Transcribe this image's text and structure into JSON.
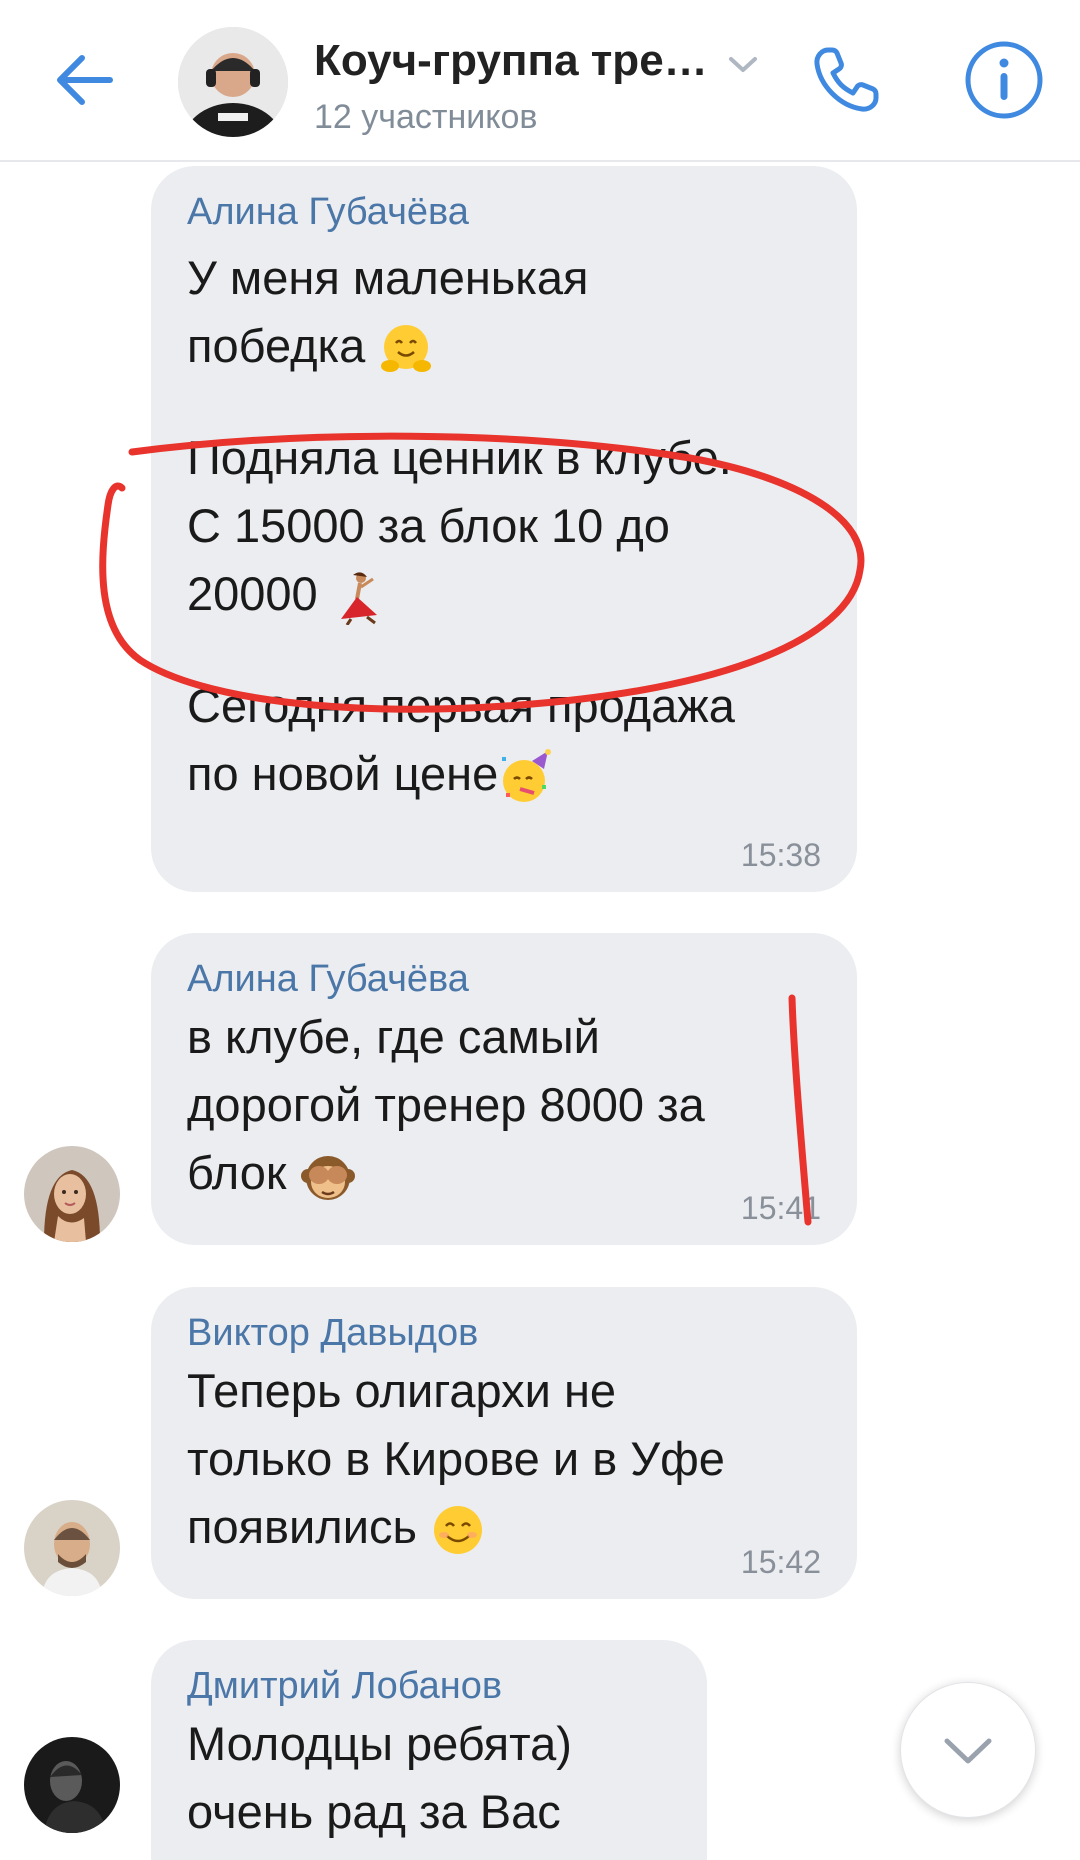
{
  "header": {
    "title": "Коуч-группа тре…",
    "subtitle": "12 участников",
    "accent_color": "#3f8ae0",
    "icons": {
      "back": "arrow-left-icon",
      "dropdown": "chevron-down-icon",
      "call": "phone-icon",
      "info": "info-icon"
    }
  },
  "messages": [
    {
      "sender": "Алина Губачёва",
      "paragraphs": [
        "У меня маленькая\nпобедка",
        "Подняла ценник в клубе.\nС 15000 за блок 10 до\n20000",
        "Сегодня первая продажа\nпо новой цене"
      ],
      "time": "15:38"
    },
    {
      "sender": "Алина Губачёва",
      "text": "в клубе, где самый\nдорогой тренер 8000 за\nблок",
      "time": "15:41"
    },
    {
      "sender": "Виктор Давыдов",
      "text": "Теперь олигархи не\nтолько в Кирове и в Уфе\nпоявились",
      "time": "15:42"
    },
    {
      "sender": "Дмитрий Лобанов",
      "text": "Молодцы ребята)\nочень рад за Вас",
      "time": ""
    }
  ],
  "colors": {
    "bubble_bg": "#ebedf0",
    "sender_name": "#4a76a8",
    "annotation_red": "#e8342c"
  }
}
